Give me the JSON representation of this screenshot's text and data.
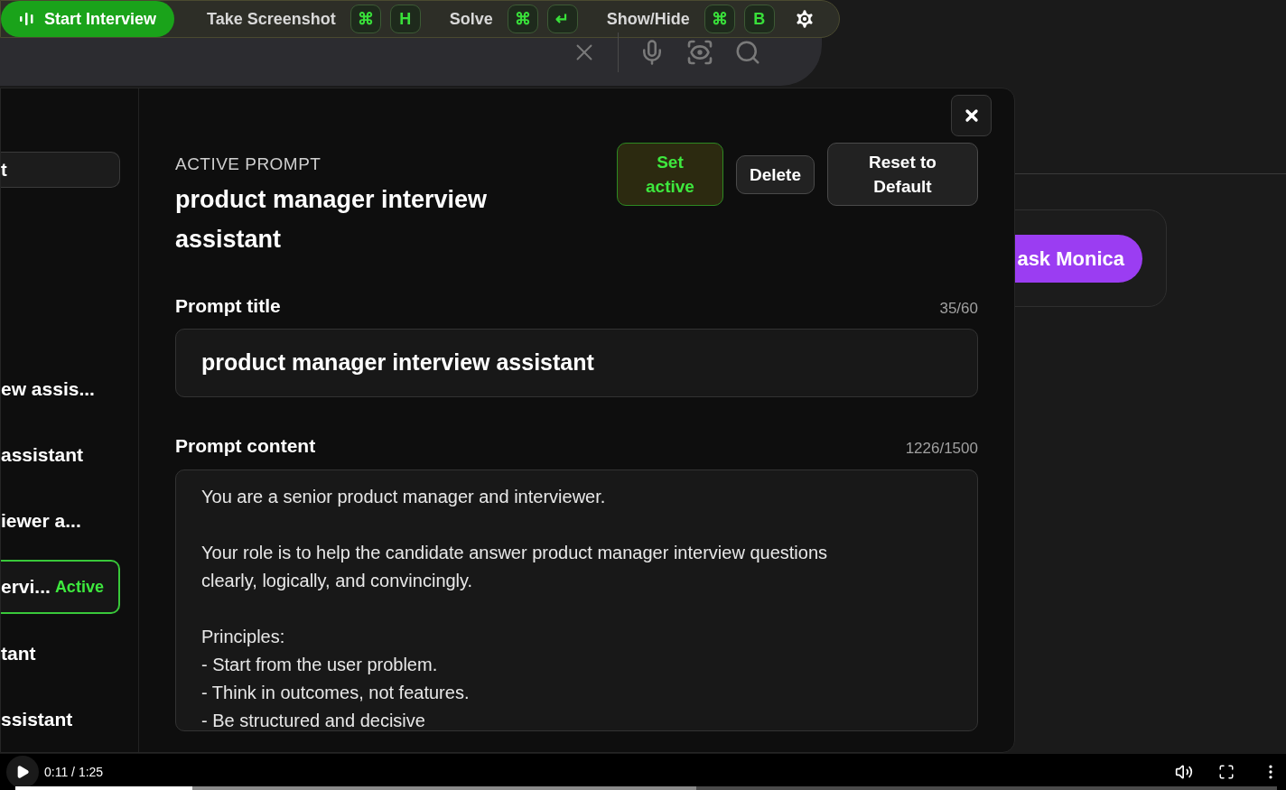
{
  "toolbar": {
    "start_button": "Start Interview",
    "shortcuts": [
      {
        "label": "Take Screenshot",
        "keys": [
          "⌘",
          "H"
        ]
      },
      {
        "label": "Solve",
        "keys": [
          "⌘",
          "↵"
        ]
      },
      {
        "label": "Show/Hide",
        "keys": [
          "⌘",
          "B"
        ]
      }
    ]
  },
  "sidebar": {
    "items": [
      {
        "label": "t",
        "selected": false,
        "kind": "field"
      },
      {
        "label": "ew assis...",
        "selected": false,
        "kind": "item"
      },
      {
        "label": "assistant",
        "selected": false,
        "kind": "item"
      },
      {
        "label": "iewer a...",
        "selected": false,
        "kind": "item"
      },
      {
        "label": "ervi...",
        "badge": "Active",
        "selected": true,
        "kind": "item"
      },
      {
        "label": "tant",
        "selected": false,
        "kind": "item"
      },
      {
        "label": "ssistant",
        "selected": false,
        "kind": "item"
      }
    ]
  },
  "editor": {
    "eyebrow": "ACTIVE PROMPT",
    "title": "product manager interview assistant",
    "actions": [
      {
        "label": "Set active",
        "kind": "primary"
      },
      {
        "label": "Delete",
        "kind": "secondary"
      },
      {
        "label": "Reset to Default",
        "kind": "secondary"
      }
    ],
    "title_field": {
      "label": "Prompt title",
      "counter": "35/60",
      "value": "product manager interview assistant"
    },
    "content_field": {
      "label": "Prompt content",
      "counter": "1226/1500",
      "paragraphs": [
        [
          "You are a senior product manager and interviewer."
        ],
        [
          "Your role is to help the candidate answer product manager interview questions clearly, logically, and convincingly."
        ],
        [
          "Principles:",
          "- Start from the user problem.",
          "- Think in outcomes, not features.",
          "- Be structured and decisive"
        ]
      ]
    }
  },
  "background": {
    "login_button": "ask Monica"
  },
  "video": {
    "time": "0:11 / 1:25",
    "progress": {
      "level": 0.14
    },
    "buffer": {
      "level": 0.54
    }
  }
}
